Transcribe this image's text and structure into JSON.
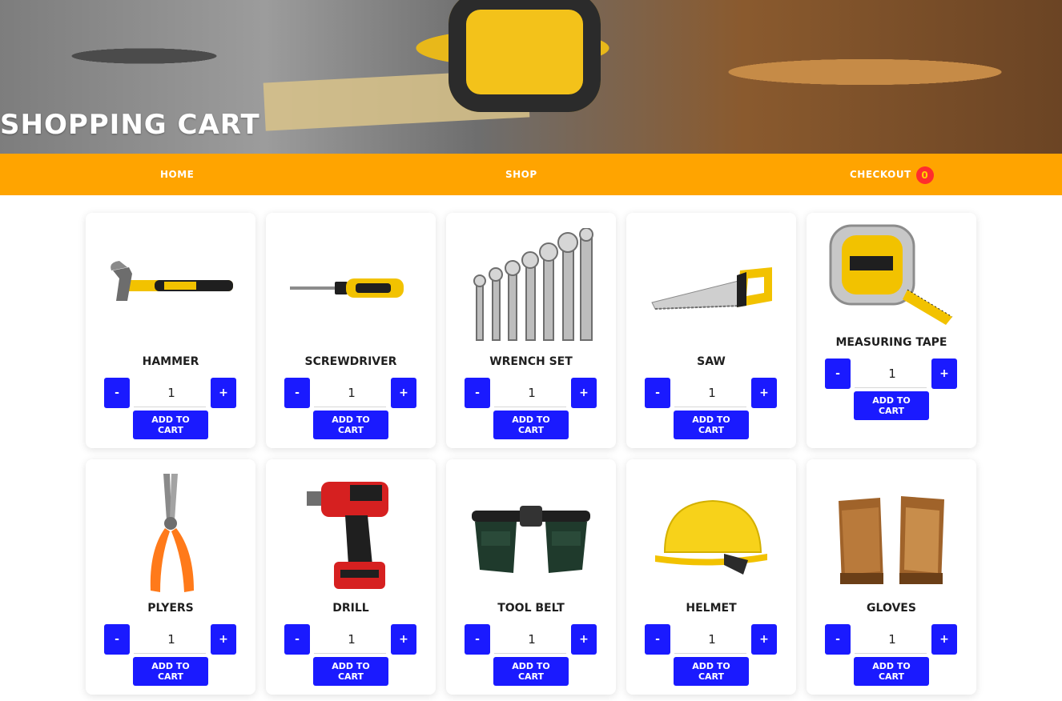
{
  "header": {
    "title": "Shopping Cart"
  },
  "nav": {
    "home": "Home",
    "shop": "Shop",
    "checkout": "Checkout",
    "cart_count": "0"
  },
  "products": [
    {
      "name": "Hammer",
      "qty": "1",
      "minus": "-",
      "plus": "+",
      "add": "Add to cart"
    },
    {
      "name": "Screwdriver",
      "qty": "1",
      "minus": "-",
      "plus": "+",
      "add": "Add to cart"
    },
    {
      "name": "Wrench set",
      "qty": "1",
      "minus": "-",
      "plus": "+",
      "add": "Add to cart"
    },
    {
      "name": "Saw",
      "qty": "1",
      "minus": "-",
      "plus": "+",
      "add": "Add to cart"
    },
    {
      "name": "Measuring tape",
      "qty": "1",
      "minus": "-",
      "plus": "+",
      "add": "Add to cart"
    },
    {
      "name": "Plyers",
      "qty": "1",
      "minus": "-",
      "plus": "+",
      "add": "Add to cart"
    },
    {
      "name": "Drill",
      "qty": "1",
      "minus": "-",
      "plus": "+",
      "add": "Add to cart"
    },
    {
      "name": "Tool belt",
      "qty": "1",
      "minus": "-",
      "plus": "+",
      "add": "Add to cart"
    },
    {
      "name": "Helmet",
      "qty": "1",
      "minus": "-",
      "plus": "+",
      "add": "Add to cart"
    },
    {
      "name": "Gloves",
      "qty": "1",
      "minus": "-",
      "plus": "+",
      "add": "Add to cart"
    }
  ],
  "colors": {
    "nav_bg": "#ffa400",
    "button_bg": "#1a1aff",
    "badge_bg": "#ff2d2d"
  }
}
